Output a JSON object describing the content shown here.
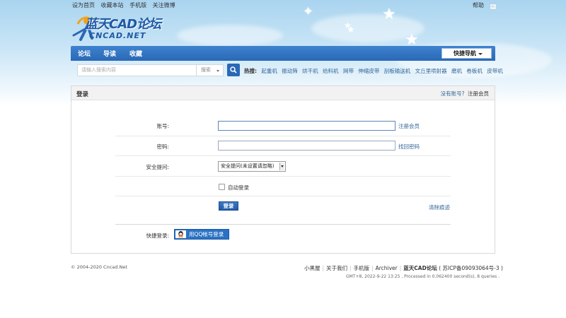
{
  "topbar": {
    "links": [
      "设为首页",
      "收藏本站",
      "手机版",
      "关注微博"
    ],
    "help": "帮助"
  },
  "logo": {
    "brand_cn": "蓝天CAD论坛",
    "brand_en": "CNCAD.NET"
  },
  "nav": {
    "items": [
      "论坛",
      "导读",
      "收藏"
    ],
    "quick_nav": "快捷导航"
  },
  "search": {
    "placeholder": "请输入搜索内容",
    "scope": "搜索",
    "hot_label": "热搜:",
    "hot_terms": [
      "起重机",
      "振动筛",
      "烘干机",
      "给料机",
      "网带",
      "伸缩皮带",
      "刮板输送机",
      "文丘里喷射器",
      "磨机",
      "卷板机",
      "皮带机"
    ]
  },
  "login": {
    "title": "登录",
    "no_account": "没有账号?",
    "register_link": "注册会员",
    "account_label": "账号:",
    "account_value": "",
    "register_member": "注册会员",
    "password_label": "密码:",
    "password_value": "",
    "find_password": "找回密码",
    "security_label": "安全提问:",
    "security_selected": "安全提问(未设置请忽略)",
    "auto_login": "自动登录",
    "submit": "登录",
    "clear_traces": "清除痕迹",
    "quick_login_label": "快捷登录:",
    "qq_login": "用QQ帐号登录"
  },
  "footer": {
    "copyright": "© 2004-2020 Cncad.Net",
    "links": [
      "小黑屋",
      "关于我们",
      "手机版",
      "Archiver"
    ],
    "site_name": "蓝天CAD论坛",
    "icp": "( 苏ICP备09093064号-3 )",
    "stats": "GMT+8, 2022-9-22 13:25 , Processed in 0.062400 second(s), 8 queries ."
  },
  "colors": {
    "nav_blue": "#2a68b6",
    "link_blue": "#336699",
    "logo_cyan": "#3aa8dc"
  }
}
